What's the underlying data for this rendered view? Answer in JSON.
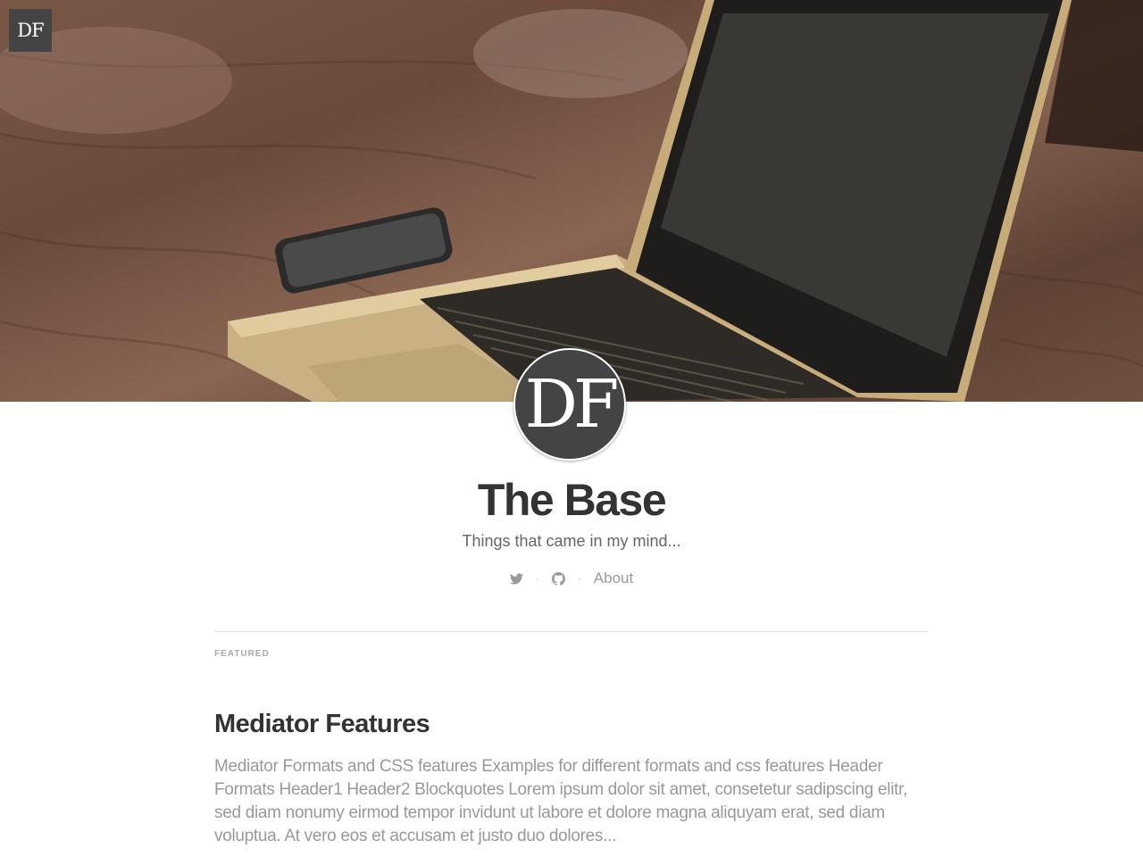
{
  "header": {
    "logo_text": "DF",
    "avatar_text": "DF",
    "title": "The Base",
    "description": "Things that came in my mind...",
    "nav": {
      "twitter_icon": "twitter-icon",
      "github_icon": "github-icon",
      "separator": "·",
      "about_label": "About"
    }
  },
  "featured_label": "Featured",
  "post": {
    "title": "Mediator Features",
    "excerpt": "Mediator Formats and CSS features Examples for different formats and css features Header Formats Header1 Header2 Blockquotes Lorem ipsum dolor sit amet, consetetur sadipscing elitr, sed diam nonumy eirmod tempor invidunt ut labore et dolore magna aliquyam erat, sed diam voluptua. At vero eos et accusam et justo duo dolores..."
  },
  "colors": {
    "logo_bg": "#444444",
    "title": "#333333",
    "muted": "#999999"
  }
}
